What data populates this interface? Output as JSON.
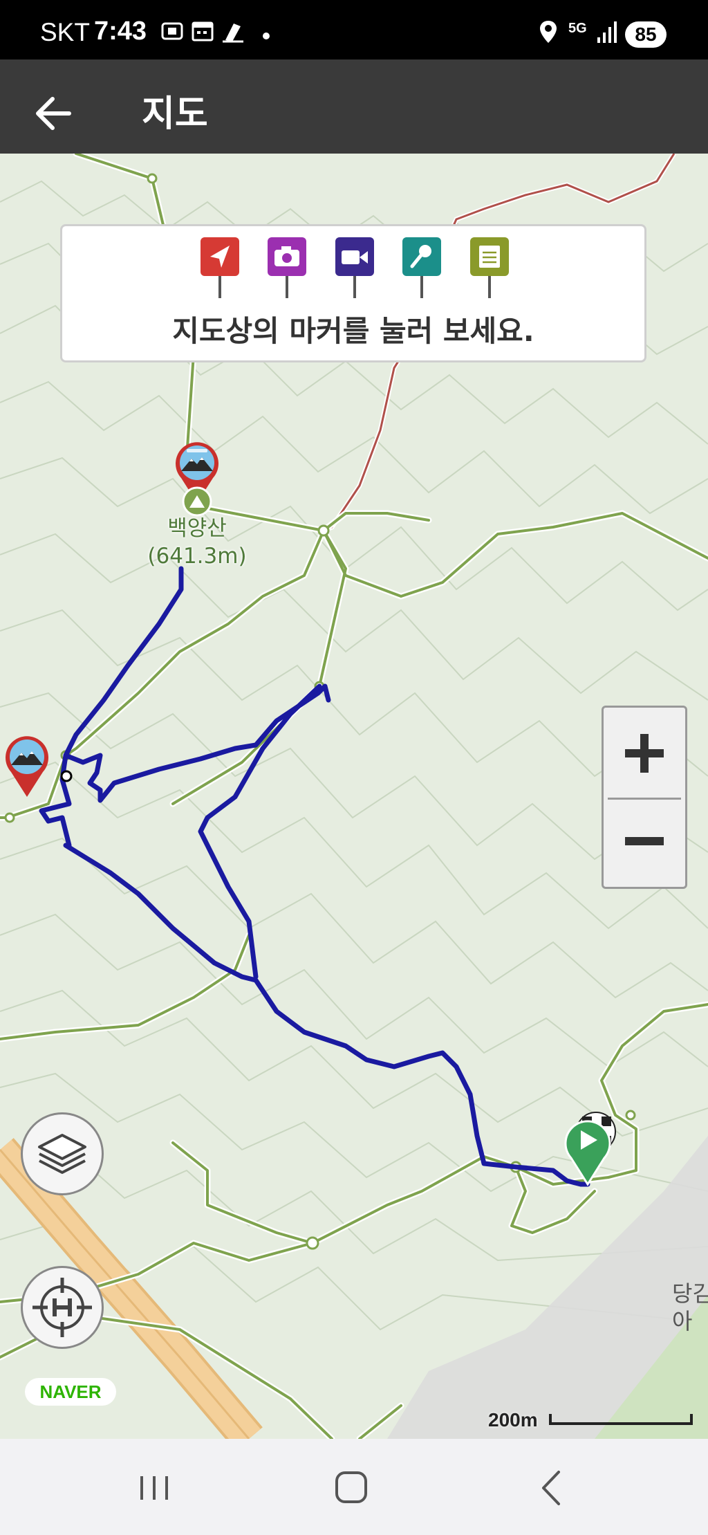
{
  "status_bar": {
    "carrier": "SKT",
    "time": "7:43",
    "network": "5G",
    "battery": "85"
  },
  "app_bar": {
    "title": "지도"
  },
  "marker_legend": {
    "hint": "지도상의 마커를 눌러 보세요.",
    "markers": [
      {
        "icon": "navigation-arrow-icon",
        "color": "#d63a34"
      },
      {
        "icon": "camera-icon",
        "color": "#9b2fb0"
      },
      {
        "icon": "video-camera-icon",
        "color": "#3b2a8e"
      },
      {
        "icon": "microphone-icon",
        "color": "#1b8f8a"
      },
      {
        "icon": "memo-icon",
        "color": "#8a9a2a"
      }
    ]
  },
  "map": {
    "peak_name": "백양산",
    "peak_elevation": "(641.3m)",
    "track_color": "#1a1aa0",
    "trail_color": "#7fa34e",
    "boundary_color": "#b0504a",
    "place_label": "당김\n아"
  },
  "zoom": {
    "in_label": "+",
    "out_label": "−"
  },
  "naver_logo": "NAVER",
  "scale": {
    "label": "200m"
  }
}
